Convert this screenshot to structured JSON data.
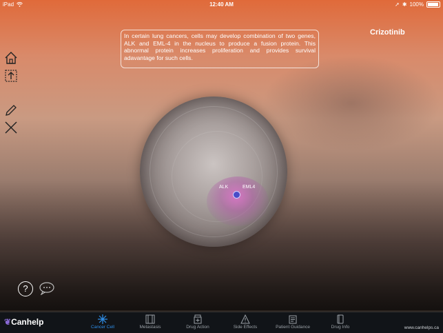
{
  "status": {
    "device": "iPad",
    "time": "12:40 AM",
    "battery": "100%"
  },
  "header": {
    "title": "Crizotinib"
  },
  "info_text": "In certain lung cancers, cells may develop combination of two genes, ALK and EML-4 in the nucleus to produce a fusion protein.  This abnormal protein increases proliferation and provides survival adavantage for such cells.",
  "cell": {
    "gene_left": "ALK",
    "gene_right": "EML4"
  },
  "tabs": [
    {
      "label": "Cancer Cell",
      "icon": "star-burst-icon",
      "active": true
    },
    {
      "label": "Metastasis",
      "icon": "film-icon",
      "active": false
    },
    {
      "label": "Drug Action",
      "icon": "medicine-bottle-icon",
      "active": false
    },
    {
      "label": "Side Effects",
      "icon": "warning-icon",
      "active": false
    },
    {
      "label": "Patient Guidance",
      "icon": "clipboard-icon",
      "active": false
    },
    {
      "label": "Drug Info",
      "icon": "document-icon",
      "active": false
    }
  ],
  "brand": {
    "name": "Canhelp"
  },
  "footer": {
    "url": "www.canhelps.ca"
  },
  "colors": {
    "active_tab": "#2f8ee8",
    "tab_bar": "#111418",
    "nucleus": "#dc6ec8"
  }
}
